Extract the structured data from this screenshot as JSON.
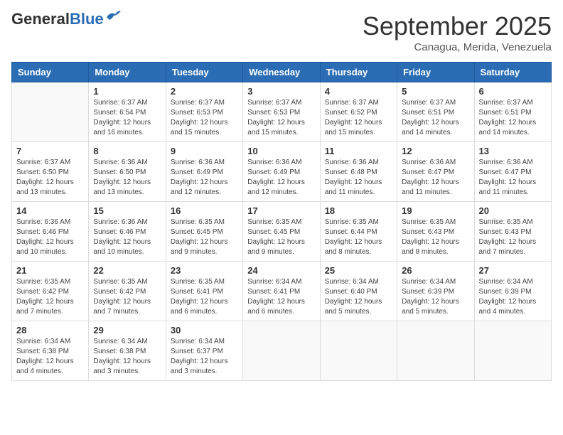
{
  "logo": {
    "general": "General",
    "blue": "Blue"
  },
  "title": "September 2025",
  "location": "Canagua, Merida, Venezuela",
  "days_of_week": [
    "Sunday",
    "Monday",
    "Tuesday",
    "Wednesday",
    "Thursday",
    "Friday",
    "Saturday"
  ],
  "weeks": [
    [
      {
        "day": "",
        "info": ""
      },
      {
        "day": "1",
        "info": "Sunrise: 6:37 AM\nSunset: 6:54 PM\nDaylight: 12 hours\nand 16 minutes."
      },
      {
        "day": "2",
        "info": "Sunrise: 6:37 AM\nSunset: 6:53 PM\nDaylight: 12 hours\nand 15 minutes."
      },
      {
        "day": "3",
        "info": "Sunrise: 6:37 AM\nSunset: 6:53 PM\nDaylight: 12 hours\nand 15 minutes."
      },
      {
        "day": "4",
        "info": "Sunrise: 6:37 AM\nSunset: 6:52 PM\nDaylight: 12 hours\nand 15 minutes."
      },
      {
        "day": "5",
        "info": "Sunrise: 6:37 AM\nSunset: 6:51 PM\nDaylight: 12 hours\nand 14 minutes."
      },
      {
        "day": "6",
        "info": "Sunrise: 6:37 AM\nSunset: 6:51 PM\nDaylight: 12 hours\nand 14 minutes."
      }
    ],
    [
      {
        "day": "7",
        "info": "Sunrise: 6:37 AM\nSunset: 6:50 PM\nDaylight: 12 hours\nand 13 minutes."
      },
      {
        "day": "8",
        "info": "Sunrise: 6:36 AM\nSunset: 6:50 PM\nDaylight: 12 hours\nand 13 minutes."
      },
      {
        "day": "9",
        "info": "Sunrise: 6:36 AM\nSunset: 6:49 PM\nDaylight: 12 hours\nand 12 minutes."
      },
      {
        "day": "10",
        "info": "Sunrise: 6:36 AM\nSunset: 6:49 PM\nDaylight: 12 hours\nand 12 minutes."
      },
      {
        "day": "11",
        "info": "Sunrise: 6:36 AM\nSunset: 6:48 PM\nDaylight: 12 hours\nand 11 minutes."
      },
      {
        "day": "12",
        "info": "Sunrise: 6:36 AM\nSunset: 6:47 PM\nDaylight: 12 hours\nand 11 minutes."
      },
      {
        "day": "13",
        "info": "Sunrise: 6:36 AM\nSunset: 6:47 PM\nDaylight: 12 hours\nand 11 minutes."
      }
    ],
    [
      {
        "day": "14",
        "info": "Sunrise: 6:36 AM\nSunset: 6:46 PM\nDaylight: 12 hours\nand 10 minutes."
      },
      {
        "day": "15",
        "info": "Sunrise: 6:36 AM\nSunset: 6:46 PM\nDaylight: 12 hours\nand 10 minutes."
      },
      {
        "day": "16",
        "info": "Sunrise: 6:35 AM\nSunset: 6:45 PM\nDaylight: 12 hours\nand 9 minutes."
      },
      {
        "day": "17",
        "info": "Sunrise: 6:35 AM\nSunset: 6:45 PM\nDaylight: 12 hours\nand 9 minutes."
      },
      {
        "day": "18",
        "info": "Sunrise: 6:35 AM\nSunset: 6:44 PM\nDaylight: 12 hours\nand 8 minutes."
      },
      {
        "day": "19",
        "info": "Sunrise: 6:35 AM\nSunset: 6:43 PM\nDaylight: 12 hours\nand 8 minutes."
      },
      {
        "day": "20",
        "info": "Sunrise: 6:35 AM\nSunset: 6:43 PM\nDaylight: 12 hours\nand 7 minutes."
      }
    ],
    [
      {
        "day": "21",
        "info": "Sunrise: 6:35 AM\nSunset: 6:42 PM\nDaylight: 12 hours\nand 7 minutes."
      },
      {
        "day": "22",
        "info": "Sunrise: 6:35 AM\nSunset: 6:42 PM\nDaylight: 12 hours\nand 7 minutes."
      },
      {
        "day": "23",
        "info": "Sunrise: 6:35 AM\nSunset: 6:41 PM\nDaylight: 12 hours\nand 6 minutes."
      },
      {
        "day": "24",
        "info": "Sunrise: 6:34 AM\nSunset: 6:41 PM\nDaylight: 12 hours\nand 6 minutes."
      },
      {
        "day": "25",
        "info": "Sunrise: 6:34 AM\nSunset: 6:40 PM\nDaylight: 12 hours\nand 5 minutes."
      },
      {
        "day": "26",
        "info": "Sunrise: 6:34 AM\nSunset: 6:39 PM\nDaylight: 12 hours\nand 5 minutes."
      },
      {
        "day": "27",
        "info": "Sunrise: 6:34 AM\nSunset: 6:39 PM\nDaylight: 12 hours\nand 4 minutes."
      }
    ],
    [
      {
        "day": "28",
        "info": "Sunrise: 6:34 AM\nSunset: 6:38 PM\nDaylight: 12 hours\nand 4 minutes."
      },
      {
        "day": "29",
        "info": "Sunrise: 6:34 AM\nSunset: 6:38 PM\nDaylight: 12 hours\nand 3 minutes."
      },
      {
        "day": "30",
        "info": "Sunrise: 6:34 AM\nSunset: 6:37 PM\nDaylight: 12 hours\nand 3 minutes."
      },
      {
        "day": "",
        "info": ""
      },
      {
        "day": "",
        "info": ""
      },
      {
        "day": "",
        "info": ""
      },
      {
        "day": "",
        "info": ""
      }
    ]
  ]
}
